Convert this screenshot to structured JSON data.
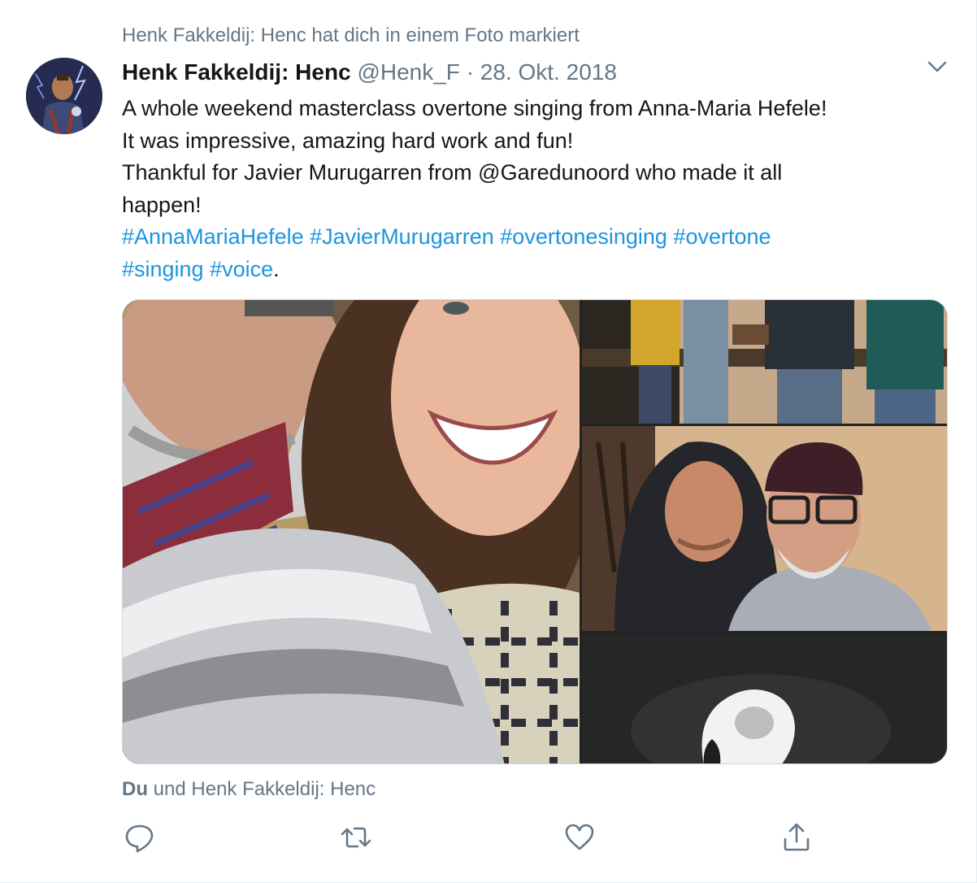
{
  "context": {
    "text": "Henk Fakkeldij: Henc hat dich in einem Foto markiert"
  },
  "header": {
    "name": "Henk Fakkeldij: Henc",
    "handle": "@Henk_F",
    "separator": "·",
    "date": "28. Okt. 2018"
  },
  "icons": {
    "caret": "chevron-down-icon",
    "reply": "reply-icon",
    "retweet": "retweet-icon",
    "like": "heart-icon",
    "share": "share-icon"
  },
  "body": {
    "line1": "A whole weekend masterclass overtone singing from Anna-Maria Hefele!",
    "line2": "It was impressive, amazing hard work and fun!",
    "line3": "Thankful for Javier Murugarren from @Garedunoord who made it all",
    "line4": "happen!",
    "hashtags_line1": [
      "#AnnaMariaHefele",
      "#JavierMurugarren",
      "#overtonesinging",
      "#overtone"
    ],
    "hashtags_line2": [
      "#singing",
      "#voice"
    ],
    "trailing": "."
  },
  "tagged": {
    "you": "Du",
    "rest": "und Henk Fakkeldij: Henc"
  },
  "colors": {
    "link": "#1b95e0",
    "secondary": "#657786",
    "text": "#14171a",
    "border": "#e6ecf0"
  }
}
